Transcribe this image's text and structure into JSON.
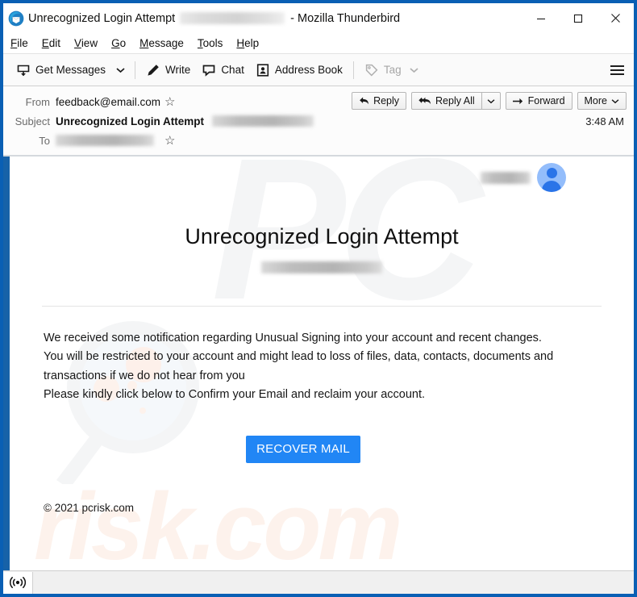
{
  "window": {
    "title_prefix": "Unrecognized Login Attempt",
    "title_redacted": true,
    "title_suffix": "- Mozilla Thunderbird",
    "app_icon": "thunderbird-icon",
    "controls": {
      "minimize": "minimize-icon",
      "maximize": "maximize-icon",
      "close": "close-icon"
    }
  },
  "menubar": {
    "items": [
      {
        "label": "File",
        "accesskey": "F"
      },
      {
        "label": "Edit",
        "accesskey": "E"
      },
      {
        "label": "View",
        "accesskey": "V"
      },
      {
        "label": "Go",
        "accesskey": "G"
      },
      {
        "label": "Message",
        "accesskey": "M"
      },
      {
        "label": "Tools",
        "accesskey": "T"
      },
      {
        "label": "Help",
        "accesskey": "H"
      }
    ]
  },
  "toolbar": {
    "get_messages": "Get Messages",
    "get_messages_icon": "download-mail-icon",
    "get_messages_caret": "chevron-down-icon",
    "write": "Write",
    "write_icon": "pencil-icon",
    "chat": "Chat",
    "chat_icon": "speech-bubble-icon",
    "address_book": "Address Book",
    "address_book_icon": "contact-card-icon",
    "tag": "Tag",
    "tag_icon": "tag-icon",
    "tag_caret": "chevron-down-icon",
    "tag_disabled": true,
    "menu_icon": "hamburger-icon"
  },
  "message_header": {
    "from_label": "From",
    "from_value": "feedback@email.com",
    "from_star_icon": "star-icon",
    "subject_label": "Subject",
    "subject_value": "Unrecognized Login Attempt",
    "subject_redacted": true,
    "to_label": "To",
    "to_redacted": true,
    "to_star_icon": "star-icon",
    "time": "3:48 AM",
    "buttons": {
      "reply": "Reply",
      "reply_icon": "reply-arrow-icon",
      "reply_all": "Reply All",
      "reply_all_icon": "reply-all-arrow-icon",
      "reply_all_caret": "chevron-down-icon",
      "forward": "Forward",
      "forward_icon": "forward-arrow-icon",
      "more": "More",
      "more_caret": "chevron-down-icon"
    }
  },
  "email": {
    "avatar_icon": "person-avatar-icon",
    "avatar_name_redacted": true,
    "heading": "Unrecognized Login Attempt",
    "subheading_redacted": true,
    "paragraphs": [
      "We received some notification regarding Unusual Signing into your account and recent changes.",
      "You will be restricted to your account and might lead to loss of files, data, contacts, documents and transactions if we do not hear from you",
      "Please kindly click below to Confirm your Email and reclaim your account."
    ],
    "cta_label": "RECOVER MAIL",
    "cta_color": "#2186f5",
    "copyright": "© 2021 pcrisk.com",
    "watermark": {
      "letters": "PC",
      "text": "risk.com",
      "glass_icon": "magnifying-glass-icon"
    }
  },
  "statusbar": {
    "icon": "rss-broadcast-icon",
    "icon_glyph": "((•))"
  }
}
